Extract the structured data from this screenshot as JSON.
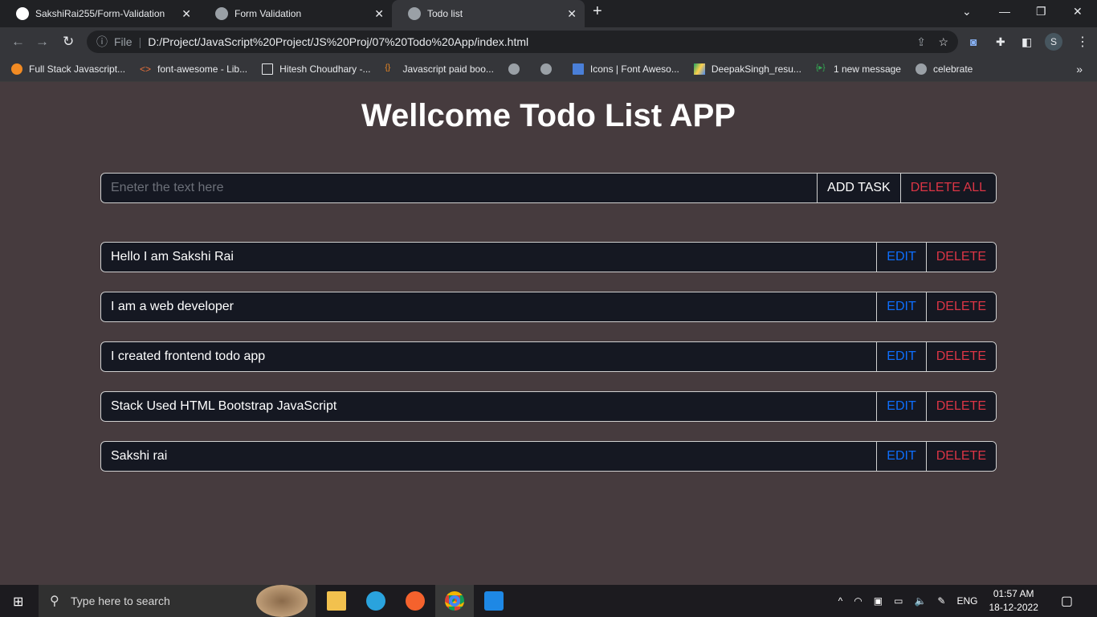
{
  "browser": {
    "tabs": [
      {
        "title": "SakshiRai255/Form-Validation",
        "icon": "github-icon"
      },
      {
        "title": "Form Validation",
        "icon": "globe-icon"
      },
      {
        "title": "Todo list",
        "icon": "globe-icon",
        "active": true
      }
    ],
    "address": {
      "scheme": "File",
      "url": "D:/Project/JavaScript%20Project/JS%20Proj/07%20Todo%20App/index.html"
    },
    "profile_initial": "S",
    "bookmarks": [
      "Full Stack Javascript...",
      "font-awesome - Lib...",
      "Hitesh Choudhary -...",
      "Javascript paid boo...",
      "",
      "",
      "Icons | Font Aweso...",
      "DeepakSingh_resu...",
      "1 new message",
      "celebrate"
    ]
  },
  "app": {
    "title": "Wellcome Todo List APP",
    "input_placeholder": "Eneter the text here",
    "add_label": "ADD TASK",
    "delete_all_label": "DELETE ALL",
    "edit_label": "EDIT",
    "delete_label": "DELETE",
    "tasks": [
      "Hello I am Sakshi Rai",
      "I am a web developer",
      "I created frontend todo app",
      "Stack Used HTML Bootstrap JavaScript",
      "Sakshi rai"
    ]
  },
  "taskbar": {
    "search_placeholder": "Type here to search",
    "lang": "ENG",
    "time": "01:57 AM",
    "date": "18-12-2022"
  }
}
